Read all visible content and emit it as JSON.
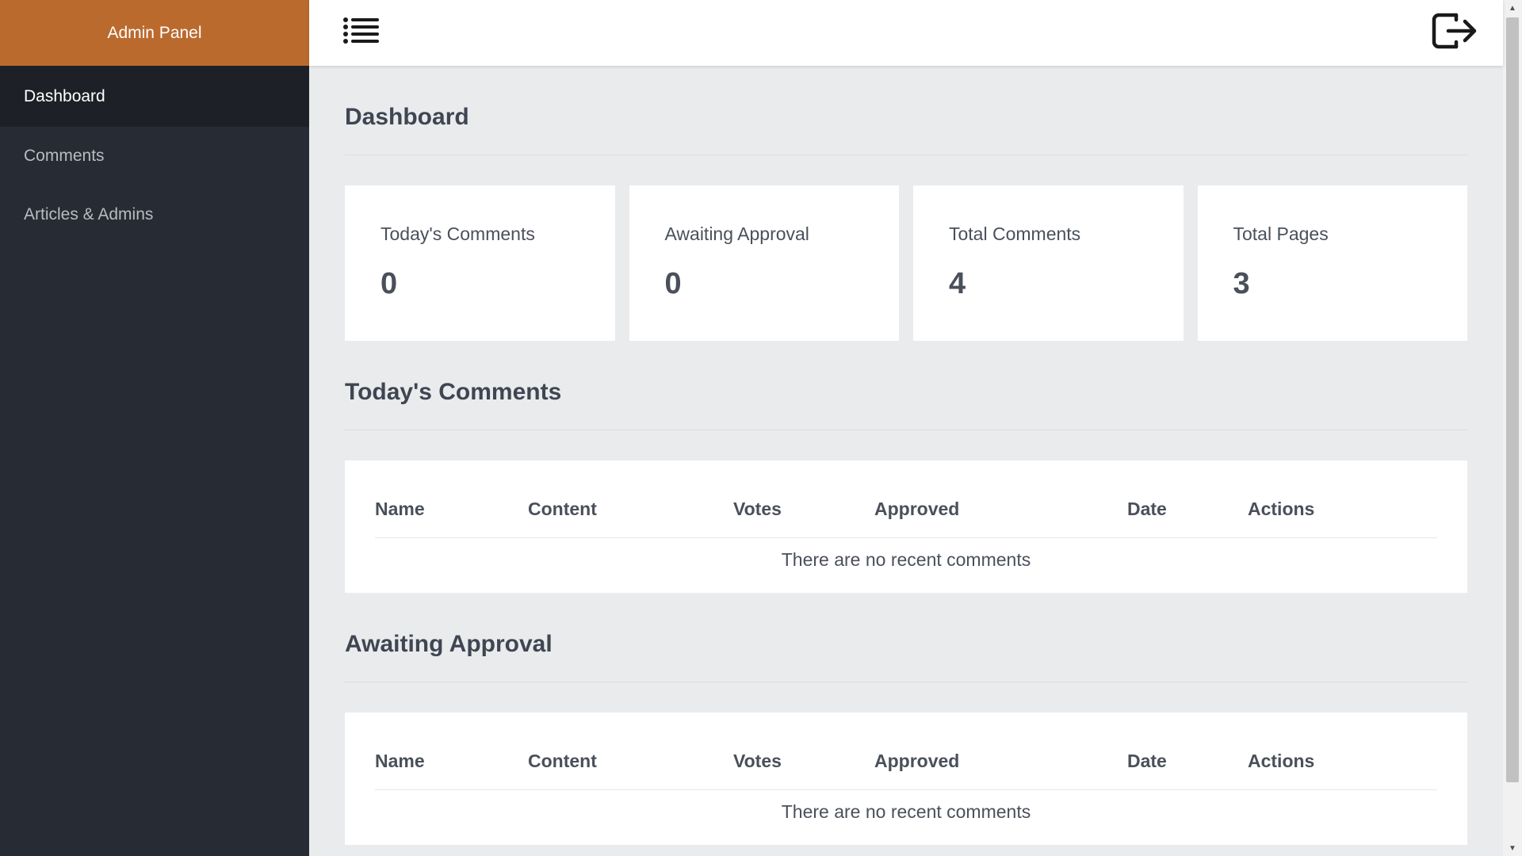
{
  "sidebar": {
    "brand": "Admin Panel",
    "items": [
      {
        "label": "Dashboard"
      },
      {
        "label": "Comments"
      },
      {
        "label": "Articles & Admins"
      }
    ]
  },
  "topbar": {
    "menu_icon": "hamburger-list-icon",
    "logout_icon": "logout-icon"
  },
  "main": {
    "title": "Dashboard",
    "stats": [
      {
        "label": "Today's Comments",
        "value": "0"
      },
      {
        "label": "Awaiting Approval",
        "value": "0"
      },
      {
        "label": "Total Comments",
        "value": "4"
      },
      {
        "label": "Total Pages",
        "value": "3"
      }
    ],
    "todays_comments": {
      "title": "Today's Comments",
      "columns": [
        "Name",
        "Content",
        "Votes",
        "Approved",
        "Date",
        "Actions"
      ],
      "empty_text": "There are no recent comments"
    },
    "awaiting_approval": {
      "title": "Awaiting Approval",
      "columns": [
        "Name",
        "Content",
        "Votes",
        "Approved",
        "Date",
        "Actions"
      ],
      "empty_text": "There are no recent comments"
    }
  },
  "colors": {
    "brand": "#bb6a2e",
    "sidebar": "#272b33",
    "sidebar_active": "#1d2026",
    "background": "#eaebed"
  }
}
